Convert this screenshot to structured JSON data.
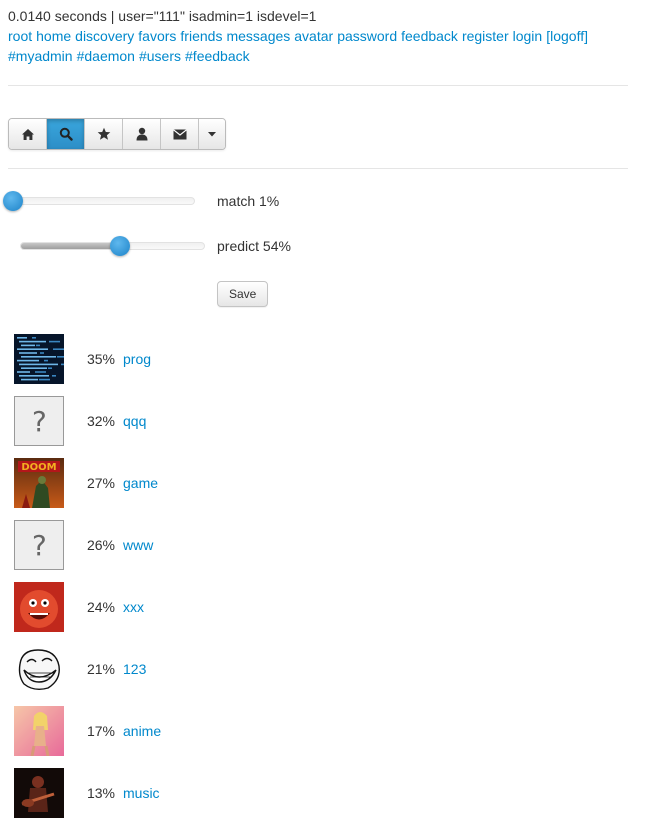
{
  "debug": {
    "timing": "0.0140 seconds",
    "separator": "|",
    "user": "user=\"111\"",
    "isadmin": "isadmin=1",
    "isdevel": "isdevel=1"
  },
  "nav": {
    "links": [
      "root",
      "home",
      "discovery",
      "favors",
      "friends",
      "messages",
      "avatar",
      "password",
      "feedback",
      "register",
      "login",
      "[logoff]"
    ],
    "tags": [
      "#myadmin",
      "#daemon",
      "#users",
      "#feedback"
    ]
  },
  "toolbar": {
    "buttons": [
      {
        "icon": "home-icon",
        "active": false
      },
      {
        "icon": "search-icon",
        "active": true
      },
      {
        "icon": "star-icon",
        "active": false
      },
      {
        "icon": "user-icon",
        "active": false
      },
      {
        "icon": "envelope-icon",
        "active": false
      },
      {
        "icon": "caret-down-icon",
        "active": false
      }
    ],
    "active_color": "#2c8ec7"
  },
  "sliders": {
    "match": {
      "label": "match 1%",
      "value": 0.01
    },
    "predict": {
      "label": "predict 54%",
      "value": 0.54
    }
  },
  "save_label": "Save",
  "tags": [
    {
      "percent": "35%",
      "name": "prog",
      "thumb": "code-screen-thumbnail"
    },
    {
      "percent": "32%",
      "name": "qqq",
      "thumb": "question-mark-placeholder"
    },
    {
      "percent": "27%",
      "name": "game",
      "thumb": "doom-cover-thumbnail"
    },
    {
      "percent": "26%",
      "name": "www",
      "thumb": "question-mark-placeholder"
    },
    {
      "percent": "24%",
      "name": "xxx",
      "thumb": "rage-face-thumbnail"
    },
    {
      "percent": "21%",
      "name": "123",
      "thumb": "trollface-thumbnail"
    },
    {
      "percent": "17%",
      "name": "anime",
      "thumb": "anime-girl-thumbnail"
    },
    {
      "percent": "13%",
      "name": "music",
      "thumb": "guitarist-thumbnail"
    }
  ],
  "colors": {
    "link": "#0088cc",
    "text": "#333333",
    "slider_thumb": "#1d83c8"
  }
}
